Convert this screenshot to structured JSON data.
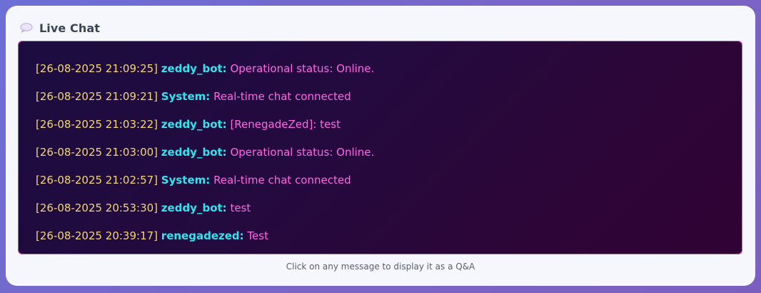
{
  "header": {
    "icon": "speech-bubble-icon",
    "title": "Live Chat"
  },
  "messages": [
    {
      "timestamp": "[26-08-2025 21:09:25]",
      "user": "zeddy_bot:",
      "text": "Operational status: Online."
    },
    {
      "timestamp": "[26-08-2025 21:09:21]",
      "user": "System:",
      "text": "Real-time chat connected"
    },
    {
      "timestamp": "[26-08-2025 21:03:22]",
      "user": "zeddy_bot:",
      "text": "[RenegadeZed]: test"
    },
    {
      "timestamp": "[26-08-2025 21:03:00]",
      "user": "zeddy_bot:",
      "text": "Operational status: Online."
    },
    {
      "timestamp": "[26-08-2025 21:02:57]",
      "user": "System:",
      "text": "Real-time chat connected"
    },
    {
      "timestamp": "[26-08-2025 20:53:30]",
      "user": "zeddy_bot:",
      "text": "test"
    },
    {
      "timestamp": "[26-08-2025 20:39:17]",
      "user": "renegadezed:",
      "text": "Test"
    }
  ],
  "footer": {
    "hint": "Click on any message to display it as a Q&A"
  },
  "colors": {
    "timestamp": "#f5d76e",
    "username": "#2fe6f0",
    "message": "#ff66e6",
    "border": "#ff2fd0"
  }
}
